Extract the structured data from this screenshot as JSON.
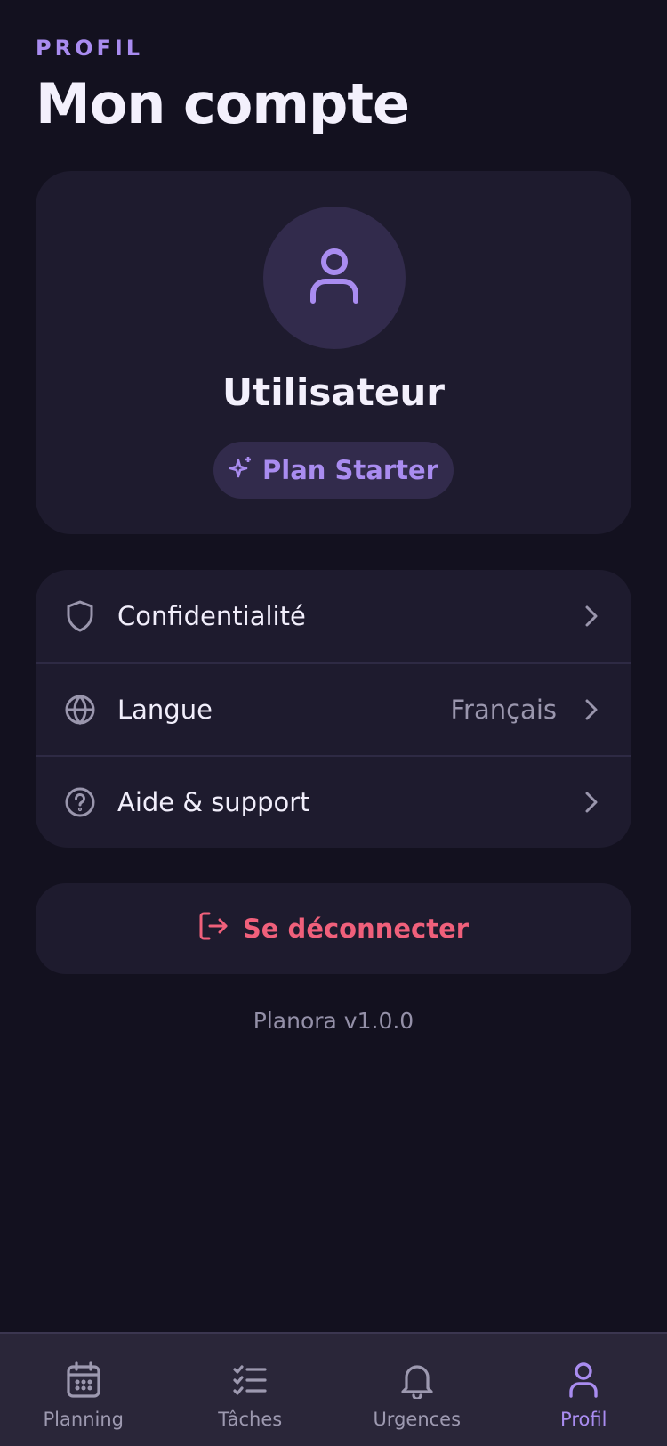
{
  "header": {
    "eyebrow": "PROFIL",
    "title": "Mon compte"
  },
  "profile": {
    "avatar_icon": "user-icon",
    "name": "Utilisateur",
    "plan_icon": "sparkles-icon",
    "plan_label": "Plan Starter"
  },
  "settings": {
    "items": [
      {
        "icon": "shield-icon",
        "label": "Confidentialité",
        "value": ""
      },
      {
        "icon": "globe-icon",
        "label": "Langue",
        "value": "Français"
      },
      {
        "icon": "help-circle-icon",
        "label": "Aide & support",
        "value": ""
      }
    ]
  },
  "logout": {
    "icon": "log-out-icon",
    "label": "Se déconnecter"
  },
  "footer": {
    "version": "Planora v1.0.0"
  },
  "tabbar": {
    "tabs": [
      {
        "icon": "calendar-icon",
        "label": "Planning",
        "active": false
      },
      {
        "icon": "checklist-icon",
        "label": "Tâches",
        "active": false
      },
      {
        "icon": "bell-icon",
        "label": "Urgences",
        "active": false
      },
      {
        "icon": "user-icon",
        "label": "Profil",
        "active": true
      }
    ]
  },
  "colors": {
    "background": "#13111f",
    "card": "#1e1b2e",
    "accent": "#a98cf0",
    "danger": "#f0607b",
    "muted": "#9a96ad"
  }
}
